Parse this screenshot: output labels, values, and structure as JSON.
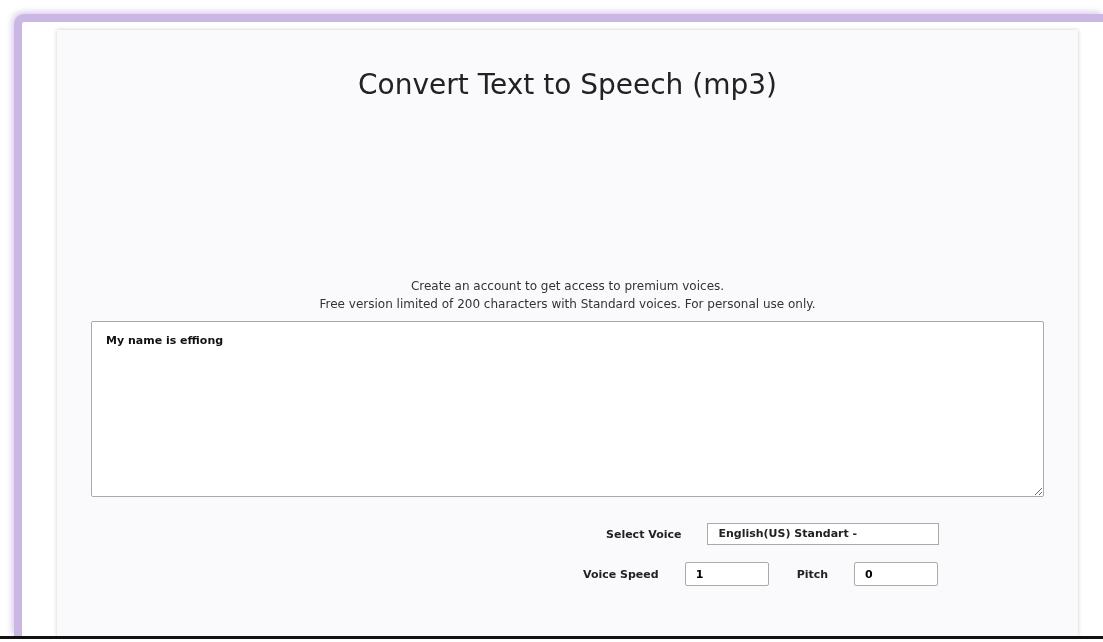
{
  "title": "Convert Text to Speech (mp3)",
  "notice": [
    "Create an account to get access to premium voices.",
    "Free version limited of 200 characters with Standard voices. For personal use only."
  ],
  "text_input": {
    "value": "My name is effiong"
  },
  "voice": {
    "label": "Select Voice",
    "value": "English(US) Standart -"
  },
  "speed": {
    "label": "Voice Speed",
    "value": "1"
  },
  "pitch": {
    "label": "Pitch",
    "value": "0"
  }
}
